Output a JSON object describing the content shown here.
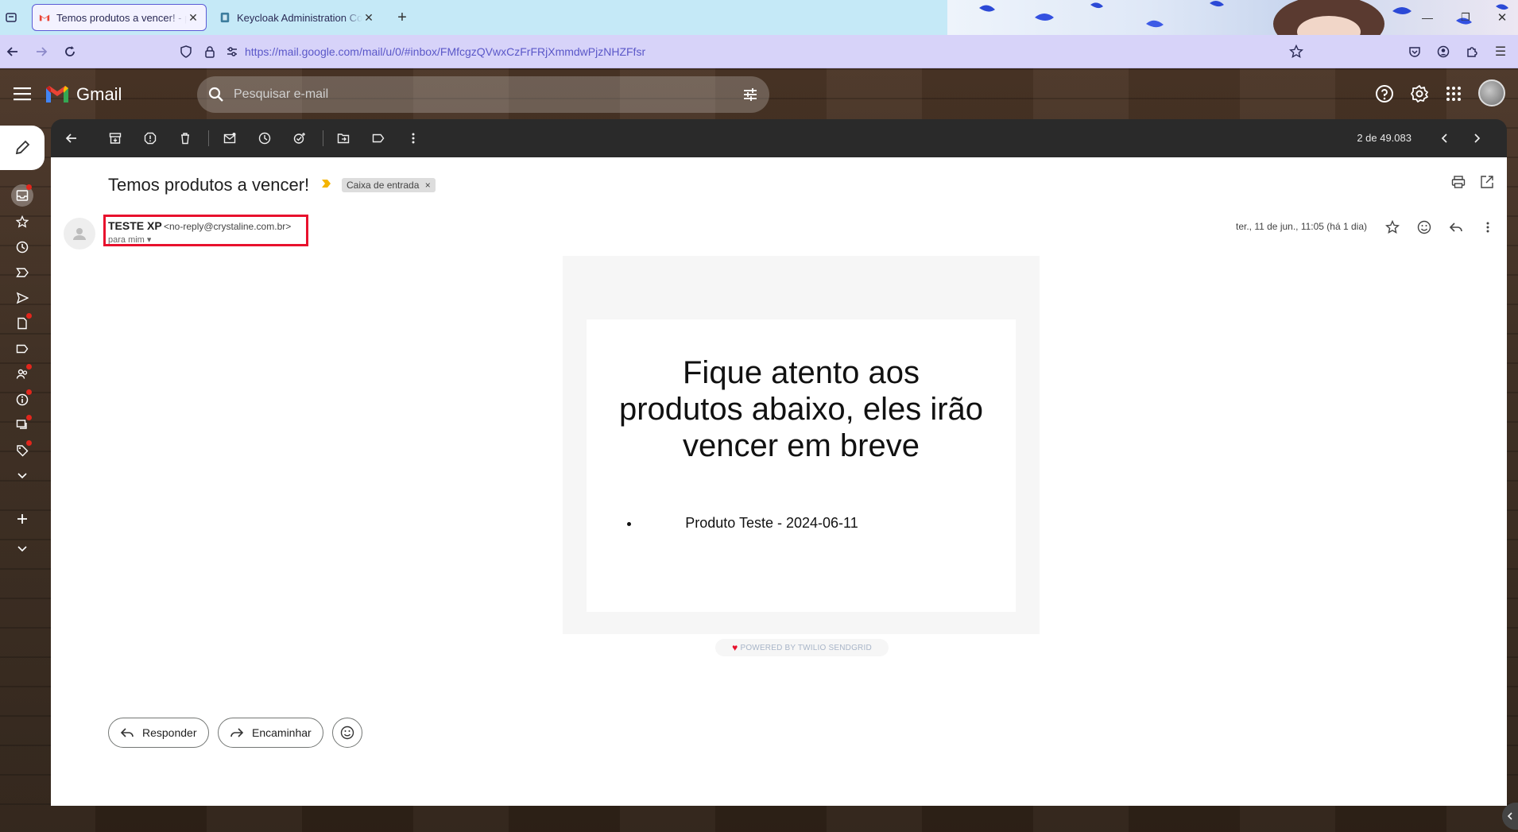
{
  "browser": {
    "tabs": [
      {
        "title": "Temos produtos a vencer! - pedro",
        "active": true
      },
      {
        "title": "Keycloak Administration Console",
        "active": false
      }
    ],
    "url": "https://mail.google.com/mail/u/0/#inbox/FMfcgzQVwxCzFrFRjXmmdwPjzNHZFfsr"
  },
  "gmail": {
    "brand": "Gmail",
    "search_placeholder": "Pesquisar e-mail",
    "pager": "2 de 49.083"
  },
  "email": {
    "subject": "Temos produtos a vencer!",
    "label": "Caixa de entrada",
    "sender_name": "TESTE XP",
    "sender_email": "<no-reply@crystaline.com.br>",
    "recipient": "para mim",
    "date": "ter., 11 de jun., 11:05 (há 1 dia)",
    "body_heading": "Fique atento aos produtos abaixo, eles irão vencer em breve",
    "items": [
      "Produto Teste - 2024-06-11"
    ],
    "footer": "POWERED BY TWILIO SENDGRID"
  },
  "actions": {
    "reply": "Responder",
    "forward": "Encaminhar"
  },
  "colors": {
    "highlight_box": "#e8112d",
    "gmail_red": "#ea4335",
    "tab_bar": "#c5e9f7",
    "nav_bar": "#d7d3f9"
  }
}
